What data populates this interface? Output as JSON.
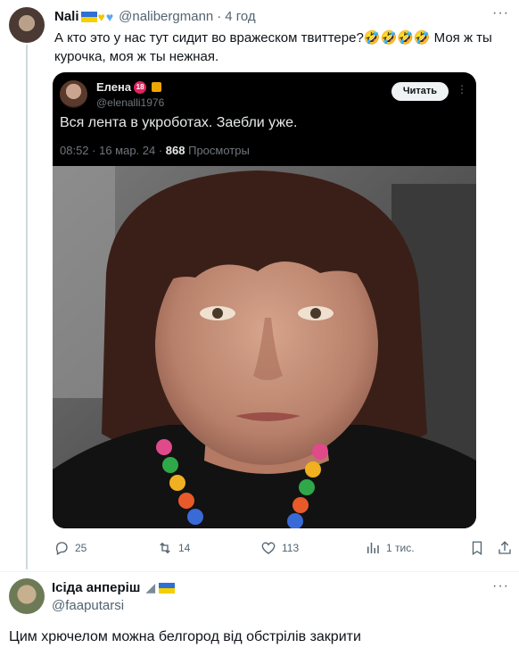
{
  "post": {
    "author_name": "Nali",
    "author_handle": "@nalibergmann",
    "separator": "·",
    "time": "4 год",
    "text": "А кто это у нас тут сидит во вражеском твиттере?🤣🤣🤣🤣 Моя ж ты курочка, моя ж ты нежная.",
    "quote": {
      "author_name": "Елена",
      "author_badge": "18",
      "author_handle": "@elenalli1976",
      "follow_label": "Читать",
      "text": "Вся лента в укроботах. Заебли уже.",
      "meta_time": "08:52 · 16 мар. 24 · ",
      "meta_views_count": "868",
      "meta_views_label": " Просмотры"
    },
    "actions": {
      "replies": "25",
      "reposts": "14",
      "likes": "113",
      "views": "1 тис."
    }
  },
  "reply": {
    "author_name": "Ісіда анперіш",
    "author_handle": "@faaputarsi",
    "text": "Цим хрючелом можна белгород від обстрілів закрити"
  },
  "colors": {
    "accent_blue": "#1d9bf0",
    "text_primary": "#0f1419",
    "text_secondary": "#536471"
  },
  "icons": [
    "ukraine-flag-icon",
    "yellow-heart-icon",
    "blue-heart-icon",
    "more-icon",
    "reply-icon",
    "repost-icon",
    "like-icon",
    "views-icon",
    "bookmark-icon",
    "share-icon",
    "shark-icon"
  ]
}
